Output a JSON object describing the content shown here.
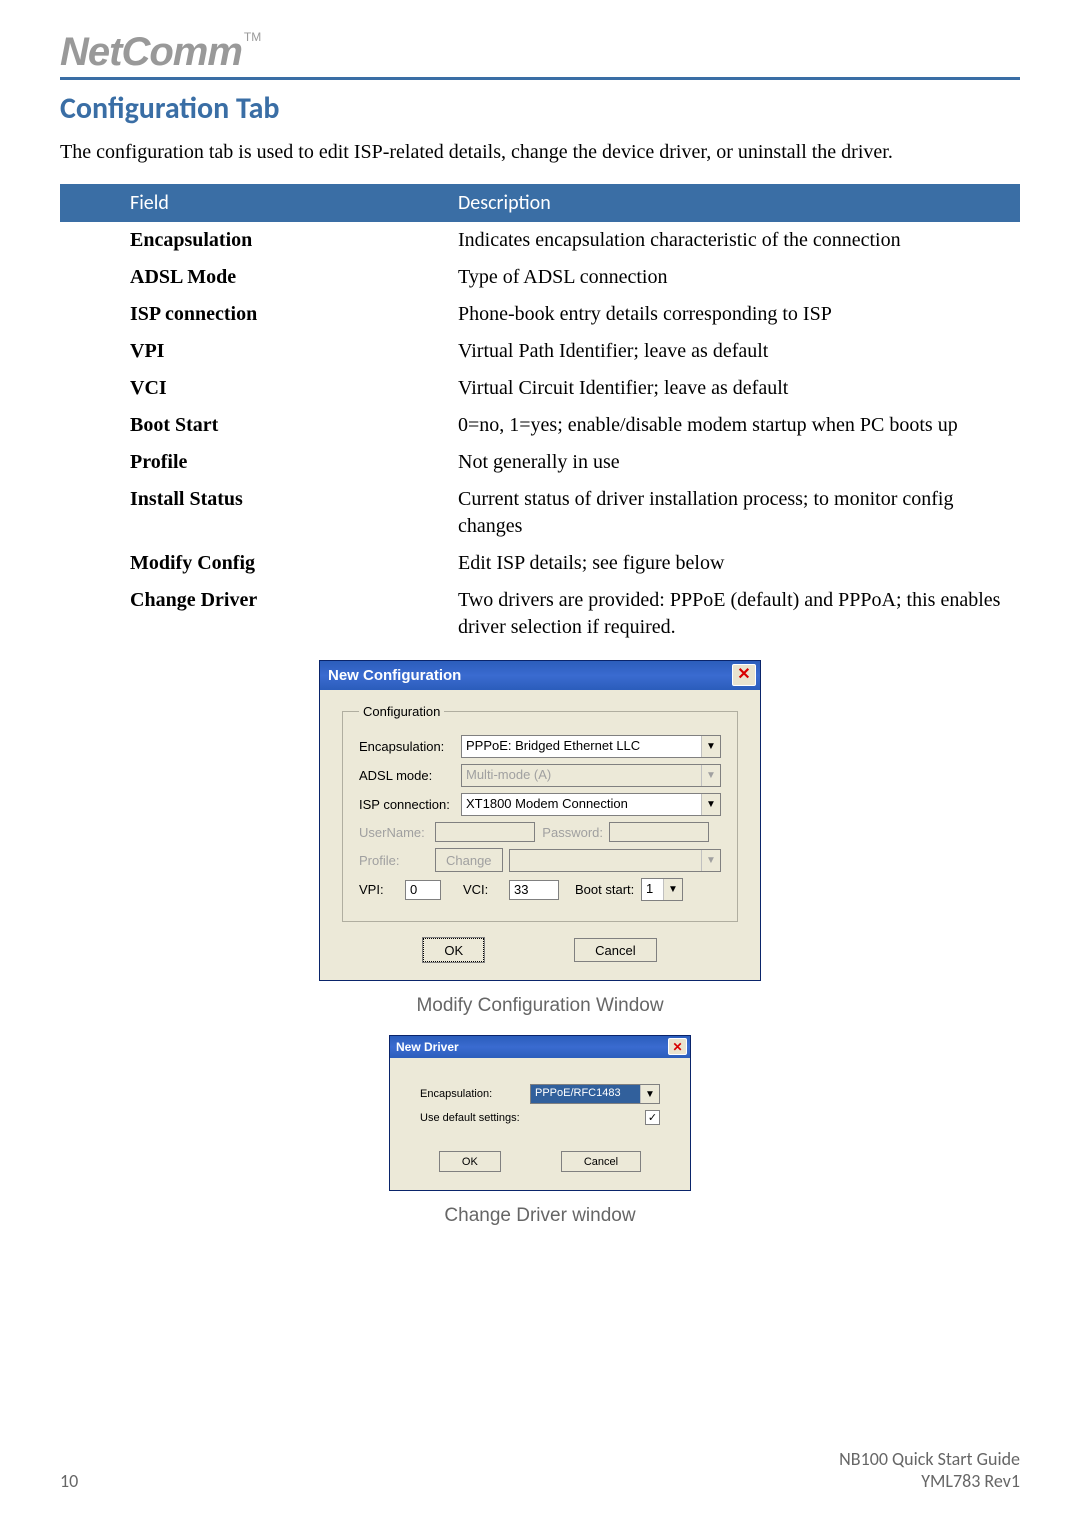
{
  "header": {
    "logo": "NetComm",
    "tm": "TM"
  },
  "section_title": "Configuration Tab",
  "intro": "The configuration tab is used to edit ISP-related details, change the device driver, or uninstall the driver.",
  "table": {
    "head_field": "Field",
    "head_desc": "Description",
    "rows": [
      {
        "field": "Encapsulation",
        "desc": "Indicates encapsulation characteristic of the connection"
      },
      {
        "field": "ADSL Mode",
        "desc": "Type of ADSL connection"
      },
      {
        "field": "ISP connection",
        "desc": "Phone-book entry details corresponding to ISP"
      },
      {
        "field": "VPI",
        "desc": "Virtual Path Identifier; leave as default"
      },
      {
        "field": "VCI",
        "desc": "Virtual Circuit Identifier; leave as default"
      },
      {
        "field": "Boot Start",
        "desc": "0=no, 1=yes; enable/disable modem startup when PC boots up"
      },
      {
        "field": "Profile",
        "desc": "Not generally in use"
      },
      {
        "field": "Install Status",
        "desc": "Current status of driver installation process; to monitor config changes"
      },
      {
        "field": "Modify Config",
        "desc": "Edit ISP details; see figure below"
      },
      {
        "field": "Change Driver",
        "desc": "Two drivers are provided: PPPoE (default) and PPPoA; this enables driver selection if required."
      }
    ]
  },
  "dialog1": {
    "title": "New Configuration",
    "group": "Configuration",
    "labels": {
      "encapsulation": "Encapsulation:",
      "adsl_mode": "ADSL mode:",
      "isp_connection": "ISP connection:",
      "username": "UserName:",
      "password": "Password:",
      "profile": "Profile:",
      "vpi": "VPI:",
      "vci": "VCI:",
      "boot_start": "Boot start:"
    },
    "values": {
      "encapsulation": "PPPoE: Bridged Ethernet LLC",
      "adsl_mode": "Multi-mode (A)",
      "isp_connection": "XT1800 Modem Connection",
      "username": "",
      "password": "",
      "profile": "",
      "vpi": "0",
      "vci": "33",
      "boot_start": "1"
    },
    "buttons": {
      "change": "Change",
      "ok": "OK",
      "cancel": "Cancel"
    }
  },
  "caption1": "Modify Configuration Window",
  "dialog2": {
    "title": "New Driver",
    "labels": {
      "encapsulation": "Encapsulation:",
      "use_default": "Use default settings:"
    },
    "values": {
      "encapsulation": "PPPoE/RFC1483",
      "use_default_checked": "✓"
    },
    "buttons": {
      "ok": "OK",
      "cancel": "Cancel"
    }
  },
  "caption2": "Change Driver window",
  "footer": {
    "page": "10",
    "doc1": "NB100 Quick Start Guide",
    "doc2": "YML783 Rev1"
  }
}
